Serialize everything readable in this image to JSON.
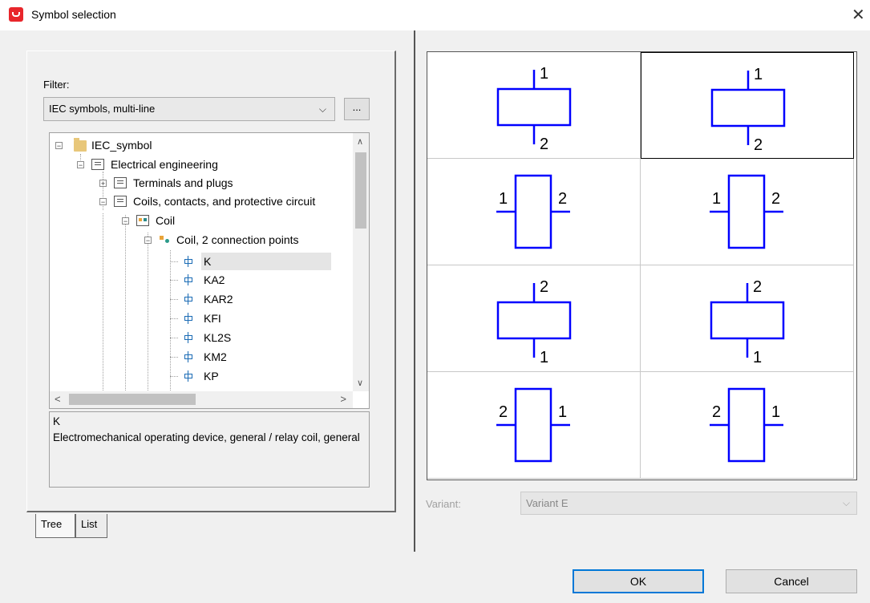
{
  "window": {
    "title": "Symbol selection"
  },
  "filter": {
    "label": "Filter:",
    "value": "IEC symbols, multi-line",
    "more_button": "..."
  },
  "tree": {
    "items": [
      {
        "label": "IEC_symbol"
      },
      {
        "label": "Electrical engineering"
      },
      {
        "label": "Terminals and plugs"
      },
      {
        "label": "Coils, contacts, and protective circuit"
      },
      {
        "label": "Coil"
      },
      {
        "label": "Coil, 2 connection points"
      },
      {
        "label": "K"
      },
      {
        "label": "KA2"
      },
      {
        "label": "KAR2"
      },
      {
        "label": "KFI"
      },
      {
        "label": "KL2S"
      },
      {
        "label": "KM2"
      },
      {
        "label": "KP"
      }
    ]
  },
  "description": {
    "name": "K",
    "text": "Electromechanical operating device, general / relay coil, general"
  },
  "tabs": [
    {
      "label": "Tree"
    },
    {
      "label": "List"
    }
  ],
  "symbols": [
    {
      "top": "1",
      "bottom": "2",
      "orientation": "horizontal"
    },
    {
      "top": "1",
      "bottom": "2",
      "orientation": "horizontal"
    },
    {
      "left": "1",
      "right": "2",
      "orientation": "vertical"
    },
    {
      "left": "1",
      "right": "2",
      "orientation": "vertical"
    },
    {
      "top": "2",
      "bottom": "1",
      "orientation": "horizontal"
    },
    {
      "top": "2",
      "bottom": "1",
      "orientation": "horizontal"
    },
    {
      "left": "2",
      "right": "1",
      "orientation": "vertical"
    },
    {
      "left": "2",
      "right": "1",
      "orientation": "vertical"
    }
  ],
  "selected_symbol": 1,
  "variant": {
    "label": "Variant:",
    "value": "Variant E"
  },
  "buttons": {
    "ok": "OK",
    "cancel": "Cancel"
  },
  "colors": {
    "symbol_stroke": "#0000ff",
    "accent": "#0078d7",
    "app_icon": "#e8262b"
  }
}
